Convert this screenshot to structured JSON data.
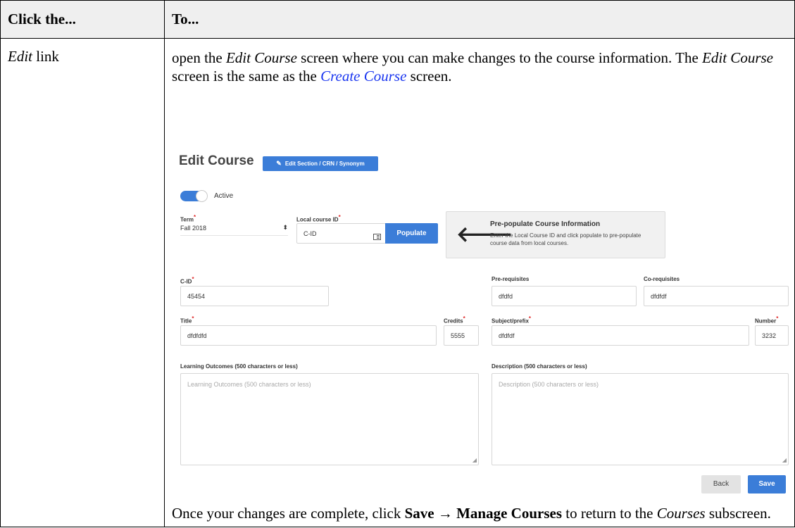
{
  "table": {
    "header_left": "Click the...",
    "header_right": "To...",
    "row": {
      "left_label": "Edit",
      "left_suffix": " link",
      "text_p1": "open the ",
      "text_edit_course_1": "Edit Course",
      "text_p2": " screen where you can make changes to the course information. The ",
      "text_edit_course_2": "Edit Course",
      "text_p3": " screen is the same as the ",
      "text_link_create_course": "Create Course",
      "text_p4": " screen.",
      "closing_p1": "Once your changes are complete, click ",
      "closing_save": "Save",
      "closing_arrow": " → ",
      "closing_manage": "Manage Courses",
      "closing_p2": " to return to the ",
      "closing_courses": "Courses",
      "closing_p3": " subscreen."
    }
  },
  "screenshot": {
    "title": "Edit Course",
    "edit_section_button": "Edit Section / CRN / Synonym",
    "active_toggle": {
      "label": "Active",
      "on": true
    },
    "term": {
      "label": "Term",
      "value": "Fall 2018"
    },
    "local_course_id": {
      "label": "Local course ID",
      "value": "C-ID"
    },
    "populate_button": "Populate",
    "prepopulate": {
      "title": "Pre-populate Course Information",
      "description": "Enter the Local Course ID and click populate to pre-populate course data from local courses."
    },
    "cid": {
      "label": "C-ID",
      "value": "45454"
    },
    "prerequisites": {
      "label": "Pre-requisites",
      "value": "dfdfd"
    },
    "corequisites": {
      "label": "Co-requisites",
      "value": "dfdfdf"
    },
    "title_field": {
      "label": "Title",
      "value": "dfdfdfd"
    },
    "credits": {
      "label": "Credits",
      "value": "5555"
    },
    "subject_prefix": {
      "label": "Subject/prefix",
      "value": "dfdfdf"
    },
    "number": {
      "label": "Number",
      "value": "3232"
    },
    "learning_outcomes": {
      "label": "Learning Outcomes (500 characters or less)",
      "placeholder": "Learning Outcomes (500 characters or less)"
    },
    "description": {
      "label": "Description (500 characters or less)",
      "placeholder": "Description (500 characters or less)"
    },
    "back_button": "Back",
    "save_button": "Save",
    "required_mark": "*",
    "colors": {
      "primary": "#3b7dd8",
      "required": "#e02b2b",
      "link": "#1a36f0"
    }
  }
}
